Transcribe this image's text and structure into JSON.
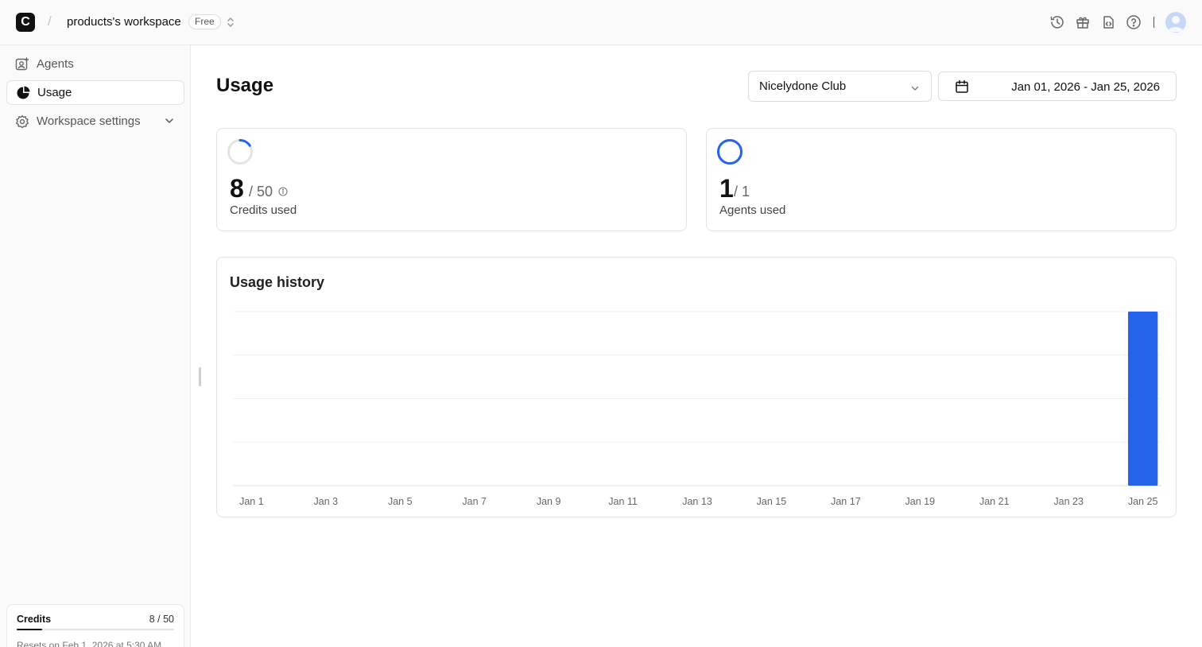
{
  "workspace": {
    "logo_letter": "C",
    "separator": "/",
    "name": "products's workspace",
    "plan": "Free"
  },
  "topbar_icons": [
    "history-icon",
    "gift-icon",
    "code-file-icon",
    "help-icon",
    "avatar"
  ],
  "sidebar": {
    "items": [
      {
        "label": "Agents",
        "icon": "agents-icon",
        "active": false
      },
      {
        "label": "Usage",
        "icon": "pie-chart-icon",
        "active": true
      },
      {
        "label": "Workspace settings",
        "icon": "gear-icon",
        "active": false,
        "expandable": true
      }
    ],
    "credits": {
      "label": "Credits",
      "value": "8 / 50",
      "used": 8,
      "total": 50,
      "reset_text": "Resets on Feb 1, 2026 at 5:30 AM"
    }
  },
  "main": {
    "title": "Usage",
    "agent_select": {
      "value": "Nicelydone Club"
    },
    "date_range": "Jan 01, 2026 - Jan 25, 2026",
    "stats": [
      {
        "value": "8",
        "of": "/ 50",
        "caption": "Credits used",
        "fraction": 0.16,
        "has_info": true
      },
      {
        "value": "1",
        "of": "/ 1",
        "caption": "Agents used",
        "fraction": 1.0,
        "has_info": false
      }
    ],
    "history_title": "Usage history"
  },
  "colors": {
    "accent": "#2563eb",
    "ring_track": "#e4e4e4"
  },
  "chart_data": {
    "type": "bar",
    "title": "Usage history",
    "categories": [
      "Jan 1",
      "Jan 2",
      "Jan 3",
      "Jan 4",
      "Jan 5",
      "Jan 6",
      "Jan 7",
      "Jan 8",
      "Jan 9",
      "Jan 10",
      "Jan 11",
      "Jan 12",
      "Jan 13",
      "Jan 14",
      "Jan 15",
      "Jan 16",
      "Jan 17",
      "Jan 18",
      "Jan 19",
      "Jan 20",
      "Jan 21",
      "Jan 22",
      "Jan 23",
      "Jan 24",
      "Jan 25"
    ],
    "tick_labels": [
      "Jan 1",
      "Jan 3",
      "Jan 5",
      "Jan 7",
      "Jan 9",
      "Jan 11",
      "Jan 13",
      "Jan 15",
      "Jan 17",
      "Jan 19",
      "Jan 21",
      "Jan 23",
      "Jan 25"
    ],
    "values": [
      0,
      0,
      0,
      0,
      0,
      0,
      0,
      0,
      0,
      0,
      0,
      0,
      0,
      0,
      0,
      0,
      0,
      0,
      0,
      0,
      0,
      0,
      0,
      0,
      8
    ],
    "ylim": [
      0,
      8
    ],
    "y_gridlines": 4,
    "grid": true,
    "color": "#2563eb"
  }
}
